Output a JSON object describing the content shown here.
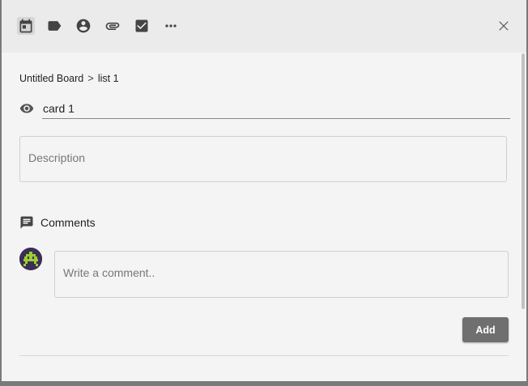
{
  "toolbar": {
    "icons": [
      "calendar-icon",
      "label-icon",
      "account-circle-icon",
      "attachment-icon",
      "checkbox-icon",
      "more-horizontal-icon"
    ],
    "close_icon": "close-icon"
  },
  "breadcrumb": {
    "board": "Untitled Board",
    "separator": ">",
    "list": "list 1"
  },
  "card": {
    "title": "card 1",
    "description_placeholder": "Description"
  },
  "comments": {
    "heading": "Comments",
    "input_placeholder": "Write a comment..",
    "add_label": "Add"
  }
}
